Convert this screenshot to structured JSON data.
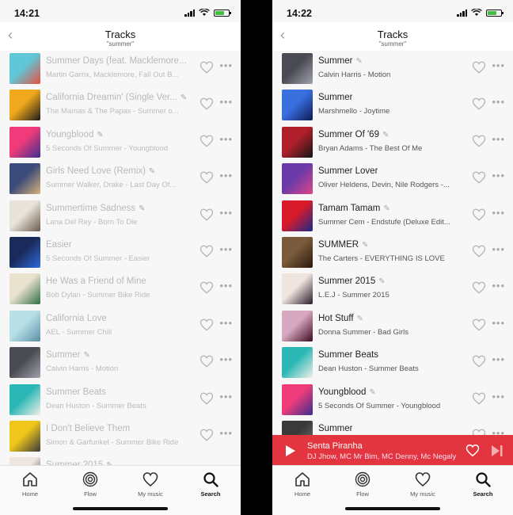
{
  "left": {
    "status_time": "14:21",
    "nav_title": "Tracks",
    "nav_subtitle": "\"summer\"",
    "tracks": [
      {
        "title": "Summer Days (feat. Macklemore...",
        "subtitle": "Martin Garrix, Macklemore, Fall Out B...",
        "verified": false,
        "art": "art-summer-days"
      },
      {
        "title": "California Dreamin' (Single Ver...",
        "subtitle": "The Mamas & The Papas - Summer o...",
        "verified": true,
        "art": "art-summer-love"
      },
      {
        "title": "Youngblood",
        "subtitle": "5 Seconds Of Summer - Youngblood",
        "verified": true,
        "art": "art-youngblood"
      },
      {
        "title": "Girls Need Love (Remix)",
        "subtitle": "Summer Walker, Drake - Last Day Of...",
        "verified": true,
        "art": "art-girls-need-love"
      },
      {
        "title": "Summertime Sadness",
        "subtitle": "Lana Del Rey - Born To Die",
        "verified": true,
        "art": "art-lana-del-rey"
      },
      {
        "title": "Easier",
        "subtitle": "5 Seconds Of Summer - Easier",
        "verified": false,
        "art": "art-easier"
      },
      {
        "title": "He Was a Friend of Mine",
        "subtitle": "Bob Dylan - Summer Bike Ride",
        "verified": false,
        "art": "art-bike-ride"
      },
      {
        "title": "California Love",
        "subtitle": "AEL - Summer Chill",
        "verified": false,
        "art": "art-summer-chill"
      },
      {
        "title": "Summer",
        "subtitle": "Calvin Harris - Motion",
        "verified": true,
        "art": "art-motion"
      },
      {
        "title": "Summer Beats",
        "subtitle": "Dean Huston - Summer Beats",
        "verified": false,
        "art": "art-summer-beats"
      },
      {
        "title": "I Don't Believe Them",
        "subtitle": "Simon & Garfunkel - Summer Bike Ride",
        "verified": false,
        "art": "art-bike-ride-2"
      },
      {
        "title": "Summer 2015",
        "subtitle": "",
        "verified": true,
        "art": "art-lej"
      }
    ]
  },
  "right": {
    "status_time": "14:22",
    "nav_title": "Tracks",
    "nav_subtitle": "\"summer\"",
    "tracks": [
      {
        "title": "Summer",
        "subtitle": "Calvin Harris - Motion",
        "verified": true,
        "art": "art-motion"
      },
      {
        "title": "Summer",
        "subtitle": "Marshmello - Joytime",
        "verified": false,
        "art": "art-joytime"
      },
      {
        "title": "Summer Of '69",
        "subtitle": "Bryan Adams - The Best Of Me",
        "verified": true,
        "art": "art-bryan-adams"
      },
      {
        "title": "Summer Lover",
        "subtitle": "Oliver Heldens, Devin, Nile Rodgers -...",
        "verified": false,
        "art": "art-summer-lover"
      },
      {
        "title": "Tamam Tamam",
        "subtitle": "Summer Cem - Endstufe (Deluxe Edit...",
        "verified": true,
        "art": "art-tamam"
      },
      {
        "title": "SUMMER",
        "subtitle": "The Carters - EVERYTHING IS LOVE",
        "verified": true,
        "art": "art-carters"
      },
      {
        "title": "Summer 2015",
        "subtitle": "L.E.J - Summer 2015",
        "verified": true,
        "art": "art-lej"
      },
      {
        "title": "Hot Stuff",
        "subtitle": "Donna Summer - Bad Girls",
        "verified": true,
        "art": "art-donna"
      },
      {
        "title": "Summer Beats",
        "subtitle": "Dean Huston - Summer Beats",
        "verified": false,
        "art": "art-summer-beats"
      },
      {
        "title": "Youngblood",
        "subtitle": "5 Seconds Of Summer - Youngblood",
        "verified": true,
        "art": "art-youngblood"
      },
      {
        "title": "Summer",
        "subtitle": "",
        "verified": false,
        "art": "art-summer-partial"
      }
    ],
    "player": {
      "title": "Senta Piranha",
      "artist": "DJ Jhow, MC Mr Bim, MC Denny, Mc Negaly"
    }
  },
  "tabs": [
    {
      "label": "Home",
      "icon": "home-icon"
    },
    {
      "label": "Flow",
      "icon": "flow-icon"
    },
    {
      "label": "My music",
      "icon": "heart-icon"
    },
    {
      "label": "Search",
      "icon": "search-icon"
    }
  ],
  "active_tab": "Search",
  "colors": {
    "player_bg": "#e2353f",
    "battery": "#3fbf3f",
    "background": "#f7f7f7"
  },
  "art_colors": {
    "art-summer-days": [
      "#5fc7d8",
      "#e8503f"
    ],
    "art-summer-love": [
      "#f0a81c",
      "#1a1a1a"
    ],
    "art-youngblood": [
      "#f03b7a",
      "#3a2f8f"
    ],
    "art-girls-need-love": [
      "#3a4a7a",
      "#d8b47a"
    ],
    "art-lana-del-rey": [
      "#e8e4dc",
      "#6b5a4a"
    ],
    "art-easier": [
      "#1a2a5a",
      "#2f6adf"
    ],
    "art-bike-ride": [
      "#e9e2cf",
      "#2e6e46"
    ],
    "art-summer-chill": [
      "#b8e0e6",
      "#5a8fa6"
    ],
    "art-motion": [
      "#4a4a52",
      "#a0a2ac"
    ],
    "art-summer-beats": [
      "#2bb7b6",
      "#f3f0e8"
    ],
    "art-bike-ride-2": [
      "#f0c61a",
      "#3a3a3a"
    ],
    "art-lej": [
      "#f0e6e0",
      "#2a1a2a"
    ],
    "art-joytime": [
      "#3a6fe0",
      "#0c1b55"
    ],
    "art-bryan-adams": [
      "#b0202a",
      "#141414"
    ],
    "art-summer-lover": [
      "#6a3aa8",
      "#e0458a"
    ],
    "art-tamam": [
      "#d81a2a",
      "#1a2a8a"
    ],
    "art-carters": [
      "#7a5a3a",
      "#2a1a10"
    ],
    "art-donna": [
      "#d8a8c0",
      "#3a0a20"
    ],
    "art-summer-partial": [
      "#3a3a3a",
      "#7a7a7a"
    ]
  }
}
